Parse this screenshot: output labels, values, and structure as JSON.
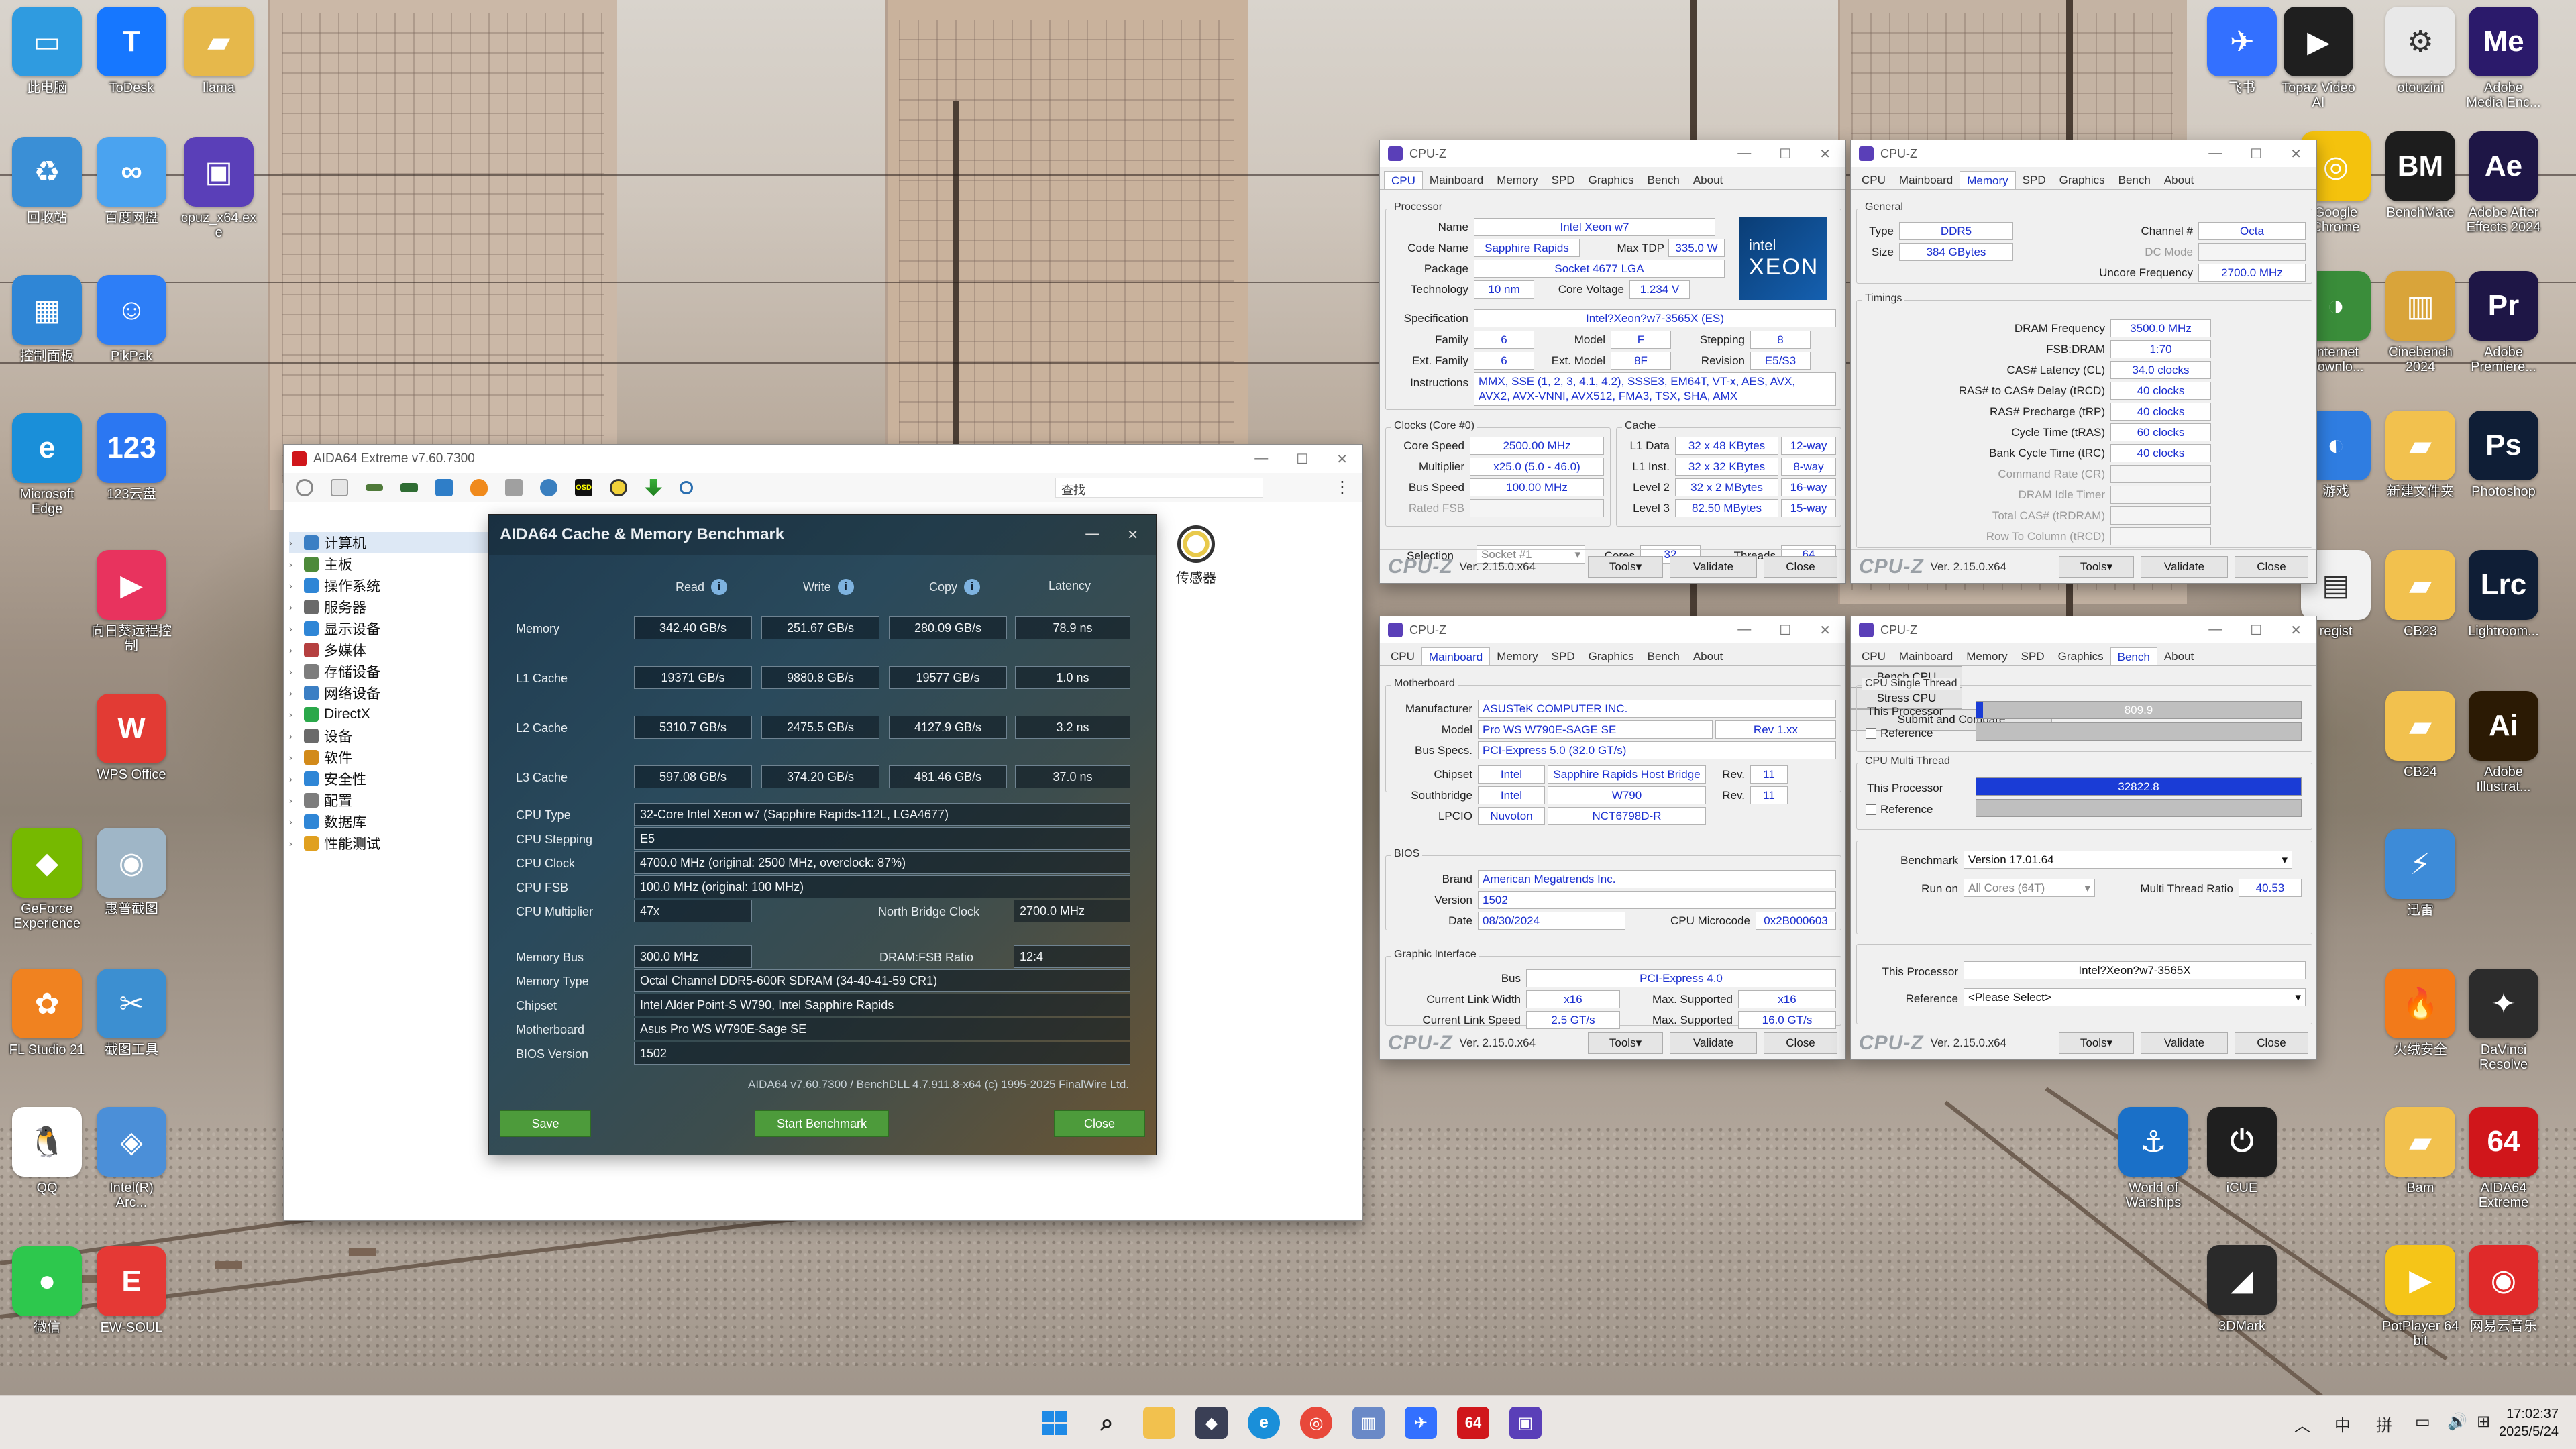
{
  "desktop": {
    "icons_left": [
      {
        "label": "此电脑",
        "color": "#2f9be0",
        "glyph": "▭"
      },
      {
        "label": "ToDesk",
        "color": "#1677ff",
        "glyph": "T"
      },
      {
        "label": "llama",
        "color": "#e6b84b",
        "glyph": "▰"
      },
      {
        "label": "回收站",
        "color": "#3a8fd6",
        "glyph": "♻"
      },
      {
        "label": "百度网盘",
        "color": "#4aa3f0",
        "glyph": "∞"
      },
      {
        "label": "cpuz_x64.ex\ne",
        "color": "#5a3fb8",
        "glyph": "▣"
      },
      {
        "label": "控制面板",
        "color": "#2f86d6",
        "glyph": "▦"
      },
      {
        "label": "PikPak",
        "color": "#2d7ef7",
        "glyph": "☺"
      },
      {
        "label": "Microsoft\nEdge",
        "color": "#1a8fd9",
        "glyph": "e"
      },
      {
        "label": "123云盘",
        "color": "#2b77f2",
        "glyph": "123"
      },
      {
        "label": "向日葵远程控\n制",
        "color": "#e8335e",
        "glyph": "▶"
      },
      {
        "label": "WPS Office",
        "color": "#e23b34",
        "glyph": "W"
      },
      {
        "label": "GeForce\nExperience",
        "color": "#76b900",
        "glyph": "◆"
      },
      {
        "label": "惠普截图",
        "color": "#9fb6c7",
        "glyph": "◉"
      },
      {
        "label": "FL Studio 21",
        "color": "#f08220",
        "glyph": "✿"
      },
      {
        "label": "截图工具",
        "color": "#3c8fd1",
        "glyph": "✂"
      },
      {
        "label": "QQ",
        "color": "#ffffff",
        "glyph": "🐧"
      },
      {
        "label": "Intel(R)\nArc...",
        "color": "#4b8fd8",
        "glyph": "◈"
      },
      {
        "label": "微信",
        "color": "#2dc84d",
        "glyph": "●"
      },
      {
        "label": "EW-SOUL",
        "color": "#e53935",
        "glyph": "E"
      }
    ],
    "icons_right": [
      {
        "label": "飞书",
        "color": "#3370ff",
        "glyph": "✈"
      },
      {
        "label": "Topaz Video\nAI",
        "color": "#1f1f1f",
        "glyph": "▶"
      },
      {
        "label": "otouzini",
        "color": "#e8e8e8",
        "glyph": "⚙"
      },
      {
        "label": "Adobe\nMedia Enc...",
        "color": "#2b1a6b",
        "glyph": "Me"
      },
      {
        "label": "Google\nChrome",
        "color": "#f4c20d",
        "glyph": "◎"
      },
      {
        "label": "BenchMate",
        "color": "#1d1d1d",
        "glyph": "BM"
      },
      {
        "label": "Adobe After\nEffects 2024",
        "color": "#1e1646",
        "glyph": "Ae"
      },
      {
        "label": "Internet\nDownlo...",
        "color": "#3a8d3a",
        "glyph": "◑"
      },
      {
        "label": "Cinebench\n2024",
        "color": "#d9a43a",
        "glyph": "▥"
      },
      {
        "label": "Adobe\nPremiere...",
        "color": "#1e1646",
        "glyph": "Pr"
      },
      {
        "label": "游戏",
        "color": "#2f7de1",
        "glyph": "◐"
      },
      {
        "label": "新建文件夹",
        "color": "#f2c14e",
        "glyph": "▰"
      },
      {
        "label": "Photoshop",
        "color": "#0f1e36",
        "glyph": "Ps"
      },
      {
        "label": "regist",
        "color": "#f2f2f2",
        "glyph": "▤"
      },
      {
        "label": "CB23",
        "color": "#f2c14e",
        "glyph": "▰"
      },
      {
        "label": "Lightroom...",
        "color": "#0f1e36",
        "glyph": "Lrc"
      },
      {
        "label": "CB24",
        "color": "#f2c14e",
        "glyph": "▰"
      },
      {
        "label": "Adobe\nIllustrat...",
        "color": "#2b1a04",
        "glyph": "Ai"
      },
      {
        "label": "迅雷",
        "color": "#3d8bd8",
        "glyph": "⚡"
      },
      {
        "label": "火绒安全",
        "color": "#f27a1a",
        "glyph": "🔥"
      },
      {
        "label": "DaVinci\nResolve",
        "color": "#2c2c2c",
        "glyph": "✦"
      },
      {
        "label": "World of\nWarships",
        "color": "#1a70c8",
        "glyph": "⚓"
      },
      {
        "label": "iCUE",
        "color": "#1f1f1f",
        "glyph": "⏻"
      },
      {
        "label": "Bam",
        "color": "#f2c14e",
        "glyph": "▰"
      },
      {
        "label": "AIDA64\nExtreme",
        "color": "#d0161b",
        "glyph": "64"
      },
      {
        "label": "3DMark",
        "color": "#2a2a2a",
        "glyph": "◢"
      },
      {
        "label": "PotPlayer 64\nbit",
        "color": "#f5c518",
        "glyph": "▶"
      },
      {
        "label": "网易云音乐",
        "color": "#e02a2a",
        "glyph": "◉"
      }
    ]
  },
  "aida": {
    "title": "AIDA64 Extreme v7.60.7300",
    "search_label": "查找",
    "tree": [
      "计算机",
      "主板",
      "操作系统",
      "服务器",
      "显示设备",
      "多媒体",
      "存储设备",
      "网络设备",
      "DirectX",
      "设备",
      "软件",
      "安全性",
      "配置",
      "数据库",
      "性能测试"
    ],
    "sensor_label": "传感器",
    "osd_label": "OSD"
  },
  "bench": {
    "title": "AIDA64 Cache & Memory Benchmark",
    "headers": {
      "read": "Read",
      "write": "Write",
      "copy": "Copy",
      "latency": "Latency"
    },
    "rows": [
      {
        "label": "Memory",
        "read": "342.40 GB/s",
        "write": "251.67 GB/s",
        "copy": "280.09 GB/s",
        "latency": "78.9 ns"
      },
      {
        "label": "L1 Cache",
        "read": "19371 GB/s",
        "write": "9880.8 GB/s",
        "copy": "19577 GB/s",
        "latency": "1.0 ns"
      },
      {
        "label": "L2 Cache",
        "read": "5310.7 GB/s",
        "write": "2475.5 GB/s",
        "copy": "4127.9 GB/s",
        "latency": "3.2 ns"
      },
      {
        "label": "L3 Cache",
        "read": "597.08 GB/s",
        "write": "374.20 GB/s",
        "copy": "481.46 GB/s",
        "latency": "37.0 ns"
      }
    ],
    "info": {
      "cpu_type_label": "CPU Type",
      "cpu_type": "32-Core Intel Xeon w7  (Sapphire Rapids-112L, LGA4677)",
      "cpu_stepping_label": "CPU Stepping",
      "cpu_stepping": "E5",
      "cpu_clock_label": "CPU Clock",
      "cpu_clock": "4700.0 MHz  (original: 2500 MHz, overclock: 87%)",
      "cpu_fsb_label": "CPU FSB",
      "cpu_fsb": "100.0 MHz  (original: 100 MHz)",
      "cpu_mult_label": "CPU Multiplier",
      "cpu_mult": "47x",
      "nb_clock_label": "North Bridge Clock",
      "nb_clock": "2700.0 MHz",
      "mem_bus_label": "Memory Bus",
      "mem_bus": "300.0 MHz",
      "dram_ratio_label": "DRAM:FSB Ratio",
      "dram_ratio": "12:4",
      "mem_type_label": "Memory Type",
      "mem_type": "Octal Channel DDR5-600R SDRAM  (34-40-41-59 CR1)",
      "chipset_label": "Chipset",
      "chipset": "Intel Alder Point-S W790, Intel Sapphire Rapids",
      "mobo_label": "Motherboard",
      "mobo": "Asus Pro WS W790E-Sage SE",
      "bios_label": "BIOS Version",
      "bios": "1502"
    },
    "footer": "AIDA64 v7.60.7300 / BenchDLL 4.7.911.8-x64  (c) 1995-2025 FinalWire Ltd.",
    "save": "Save",
    "start": "Start Benchmark",
    "close": "Close"
  },
  "cpuz_common": {
    "title": "CPU-Z",
    "tabs": [
      "CPU",
      "Mainboard",
      "Memory",
      "SPD",
      "Graphics",
      "Bench",
      "About"
    ],
    "logo": "CPU-Z",
    "version": "Ver. 2.15.0.x64",
    "tools": "Tools",
    "validate": "Validate",
    "close": "Close"
  },
  "cpuz_cpu": {
    "processor_group": "Processor",
    "name_label": "Name",
    "name": "Intel Xeon w7",
    "codename_label": "Code Name",
    "codename": "Sapphire Rapids",
    "maxtdp_label": "Max TDP",
    "maxtdp": "335.0 W",
    "package_label": "Package",
    "package": "Socket 4677 LGA",
    "tech_label": "Technology",
    "tech": "10 nm",
    "corev_label": "Core Voltage",
    "corev": "1.234 V",
    "spec_label": "Specification",
    "spec": "Intel?Xeon?w7-3565X (ES)",
    "family_label": "Family",
    "family": "6",
    "model_label": "Model",
    "model": "F",
    "stepping_label": "Stepping",
    "stepping": "8",
    "extfamily_label": "Ext. Family",
    "extfamily": "6",
    "extmodel_label": "Ext. Model",
    "extmodel": "8F",
    "revision_label": "Revision",
    "revision": "E5/S3",
    "instr_label": "Instructions",
    "instr1": "MMX, SSE (1, 2, 3, 4.1, 4.2), SSSE3, EM64T, VT-x, AES, AVX,",
    "instr2": "AVX2, AVX-VNNI, AVX512, FMA3, TSX, SHA, AMX",
    "clocks_group": "Clocks (Core #0)",
    "corespeed_label": "Core Speed",
    "corespeed": "2500.00 MHz",
    "mult_label": "Multiplier",
    "mult": "x25.0 (5.0 - 46.0)",
    "busspeed_label": "Bus Speed",
    "busspeed": "100.00 MHz",
    "ratedfsb_label": "Rated FSB",
    "cache_group": "Cache",
    "l1d_label": "L1 Data",
    "l1d": "32 x 48 KBytes",
    "l1d_way": "12-way",
    "l1i_label": "L1 Inst.",
    "l1i": "32 x 32 KBytes",
    "l1i_way": "8-way",
    "l2_label": "Level 2",
    "l2": "32 x 2 MBytes",
    "l2_way": "16-way",
    "l3_label": "Level 3",
    "l3": "82.50 MBytes",
    "l3_way": "15-way",
    "selection_label": "Selection",
    "selection": "Socket #1",
    "cores_label": "Cores",
    "cores": "32",
    "threads_label": "Threads",
    "threads": "64",
    "intel_brand": "intel",
    "intel_product": "XEON"
  },
  "cpuz_mem": {
    "general_group": "General",
    "type_label": "Type",
    "type": "DDR5",
    "channel_label": "Channel #",
    "channel": "Octa",
    "size_label": "Size",
    "size": "384 GBytes",
    "dcmode_label": "DC Mode",
    "uncore_label": "Uncore Frequency",
    "uncore": "2700.0 MHz",
    "timings_group": "Timings",
    "t": [
      {
        "label": "DRAM Frequency",
        "value": "3500.0 MHz",
        "gray": false
      },
      {
        "label": "FSB:DRAM",
        "value": "1:70",
        "gray": false
      },
      {
        "label": "CAS# Latency (CL)",
        "value": "34.0 clocks",
        "gray": false
      },
      {
        "label": "RAS# to CAS# Delay (tRCD)",
        "value": "40 clocks",
        "gray": false
      },
      {
        "label": "RAS# Precharge (tRP)",
        "value": "40 clocks",
        "gray": false
      },
      {
        "label": "Cycle Time (tRAS)",
        "value": "60 clocks",
        "gray": false
      },
      {
        "label": "Bank Cycle Time (tRC)",
        "value": "40 clocks",
        "gray": false
      },
      {
        "label": "Command Rate (CR)",
        "value": "",
        "gray": true
      },
      {
        "label": "DRAM Idle Timer",
        "value": "",
        "gray": true
      },
      {
        "label": "Total CAS# (tRDRAM)",
        "value": "",
        "gray": true
      },
      {
        "label": "Row To Column (tRCD)",
        "value": "",
        "gray": true
      }
    ]
  },
  "cpuz_mb": {
    "mb_group": "Motherboard",
    "manu_label": "Manufacturer",
    "manu": "ASUSTeK COMPUTER INC.",
    "model_label": "Model",
    "model": "Pro WS W790E-SAGE SE",
    "rev": "Rev 1.xx",
    "busspec_label": "Bus Specs.",
    "busspec": "PCI-Express 5.0 (32.0 GT/s)",
    "chipset_label": "Chipset",
    "chipset_v": "Intel",
    "chipset_n": "Sapphire Rapids Host Bridge",
    "chipset_rev_label": "Rev.",
    "chipset_rev": "11",
    "south_label": "Southbridge",
    "south_v": "Intel",
    "south_n": "W790",
    "south_rev_label": "Rev.",
    "south_rev": "11",
    "lpcio_label": "LPCIO",
    "lpcio_v": "Nuvoton",
    "lpcio_n": "NCT6798D-R",
    "bios_group": "BIOS",
    "brand_label": "Brand",
    "brand": "American Megatrends Inc.",
    "version_label": "Version",
    "version": "1502",
    "date_label": "Date",
    "date": "08/30/2024",
    "microcode_label": "CPU Microcode",
    "microcode": "0x2B000603",
    "gi_group": "Graphic Interface",
    "bus_label": "Bus",
    "bus": "PCI-Express 4.0",
    "clw_label": "Current Link Width",
    "clw": "x16",
    "msw_label": "Max. Supported",
    "msw": "x16",
    "cls_label": "Current Link Speed",
    "cls": "2.5 GT/s",
    "mss_label": "Max. Supported",
    "mss": "16.0 GT/s"
  },
  "cpuz_bench": {
    "single_group": "CPU Single Thread",
    "multi_group": "CPU Multi Thread",
    "this_label": "This Processor",
    "ref_label": "Reference",
    "single_value": "809.9",
    "single_fraction": 0.02,
    "multi_value": "32822.8",
    "multi_fraction": 1.0,
    "benchmark_label": "Benchmark",
    "benchmark": "Version 17.01.64",
    "runon_label": "Run on",
    "runon": "All Cores (64T)",
    "mtr_label": "Multi Thread Ratio",
    "mtr": "40.53",
    "bench_cpu": "Bench CPU",
    "stress_cpu": "Stress CPU",
    "submit": "Submit and Compare",
    "this_proc_label": "This Processor",
    "this_proc": "Intel?Xeon?w7-3565X",
    "reference_label": "Reference",
    "reference": "<Please Select>"
  },
  "taskbar": {
    "time": "17:02:37",
    "date": "2025/5/24",
    "ime1": "中",
    "ime2": "拼"
  }
}
